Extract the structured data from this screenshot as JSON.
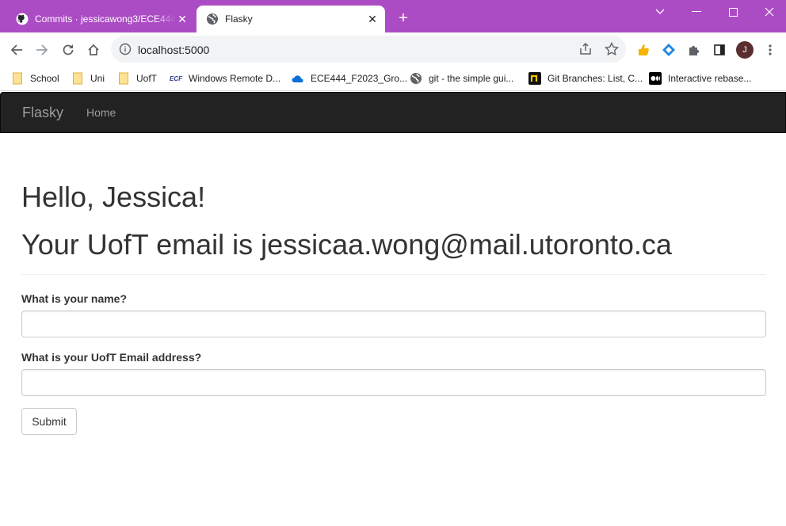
{
  "browser": {
    "tabs": [
      {
        "title": "Commits · jessicawong3/ECE444-",
        "active": false,
        "icon": "github-icon"
      },
      {
        "title": "Flasky",
        "active": true,
        "icon": "globe-icon"
      }
    ],
    "new_tab_label": "+",
    "close_label": "✕",
    "url": "localhost:5000",
    "avatar_letter": "J",
    "colors": {
      "titlebar": "#ac4cc4",
      "navbar": "#222222"
    }
  },
  "bookmarks": [
    {
      "label": "School",
      "icon": "folder-icon"
    },
    {
      "label": "Uni",
      "icon": "folder-icon"
    },
    {
      "label": "UofT",
      "icon": "folder-icon"
    },
    {
      "label": "Windows Remote D...",
      "icon": "ecf-icon"
    },
    {
      "label": "ECE444_F2023_Gro...",
      "icon": "onedrive-icon"
    },
    {
      "label": "git - the simple gui...",
      "icon": "globe-icon"
    },
    {
      "label": "Git Branches: List, C...",
      "icon": "n-icon"
    },
    {
      "label": "Interactive rebase...",
      "icon": "medium-icon"
    }
  ],
  "nav": {
    "brand": "Flasky",
    "home": "Home"
  },
  "page": {
    "greeting": "Hello, Jessica!",
    "email_line": "Your UofT email is jessicaa.wong@mail.utoronto.ca",
    "form": {
      "name_label": "What is your name?",
      "name_value": "",
      "email_label": "What is your UofT Email address?",
      "email_value": "",
      "submit_label": "Submit"
    }
  }
}
